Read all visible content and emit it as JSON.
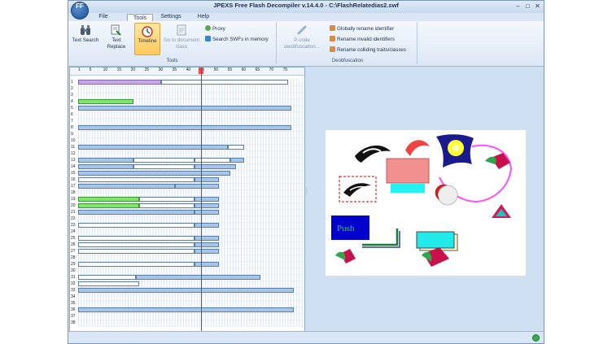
{
  "window": {
    "title": "JPEXS Free Flash Decompiler v.14.4.0 - C:\\FlashRelatedias2.swf",
    "logo_text": "FF"
  },
  "menu": [
    "File",
    "Tools",
    "Settings",
    "Help"
  ],
  "menu_active": "Tools",
  "ribbon": {
    "tools_group_label": "Tools",
    "deobf_group_label": "Deobfuscation",
    "buttons": {
      "text_search": "Text Search",
      "text_replace": "Text Replace",
      "timeline": "Timeline",
      "goto_document_class": "Go to document class",
      "proxy": "Proxy",
      "search_swfs": "Search SWFs in memory",
      "pcode_deobf": "P-code deobfuscation...",
      "global_rename": "Globally rename identifier",
      "rename_invalid": "Rename invalid identifiers",
      "rename_colliding": "Rename colliding traits/classes"
    }
  },
  "timeline": {
    "ruler_ticks": [
      "1",
      "5",
      "10",
      "15",
      "20",
      "25",
      "30",
      "35",
      "40",
      "45",
      "50",
      "55",
      "60",
      "65",
      "70",
      "75"
    ],
    "playhead_frame": 45,
    "layers": [
      "1",
      "2",
      "3",
      "4",
      "5",
      "6",
      "7",
      "8",
      "9",
      "10",
      "11",
      "12",
      "13",
      "14",
      "15",
      "16",
      "17",
      "18",
      "19",
      "20",
      "21",
      "22",
      "23",
      "24",
      "25",
      "26",
      "27",
      "28",
      "29",
      "30",
      "31",
      "32",
      "33",
      "34",
      "35",
      "36",
      "37",
      "38"
    ]
  },
  "stage": {
    "push_button_label": "Push"
  },
  "colors": {
    "accent": "#ffc95c",
    "playhead": "#e02020",
    "bar_blue": "#a9c6e6",
    "bar_green": "#7ee66f",
    "bar_purple": "#c9a6e6"
  },
  "icons": {
    "status": "status-ok-icon"
  }
}
